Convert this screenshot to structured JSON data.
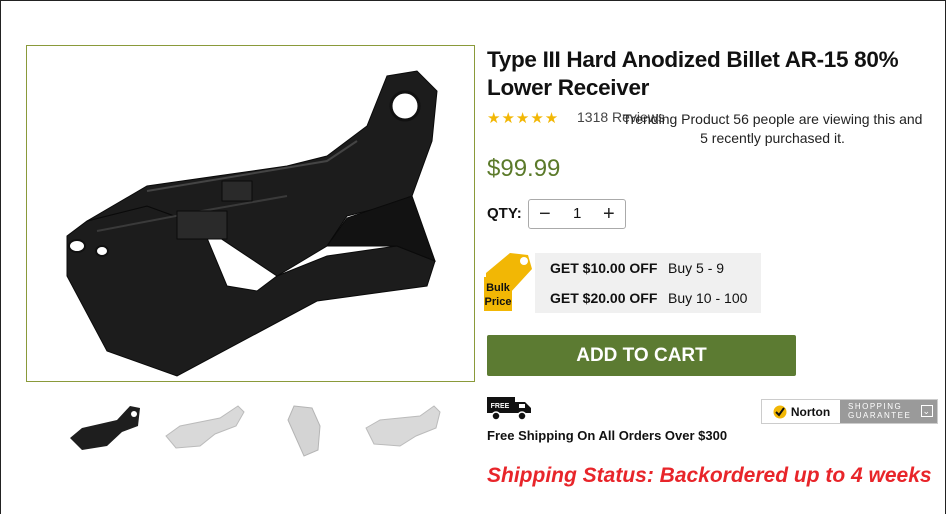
{
  "product": {
    "title": "Type III Hard Anodized Billet AR-15 80% Lower Receiver",
    "stars": "★★★★★",
    "review_count": "1318 Reviews",
    "trending_text": "Trending Product 56 people are viewing this and 5 recently purchased it.",
    "price": "$99.99"
  },
  "quantity": {
    "label": "QTY:",
    "minus": "−",
    "value": "1",
    "plus": "+"
  },
  "bulk_pricing": {
    "badge_line1": "Bulk",
    "badge_line2": "Price",
    "tiers": [
      {
        "offer": "GET $10.00 OFF",
        "range": "Buy 5 - 9"
      },
      {
        "offer": "GET $20.00 OFF",
        "range": "Buy 10 - 100"
      }
    ]
  },
  "cart": {
    "button_label": "ADD TO CART"
  },
  "shipping": {
    "truck_badge": "FREE",
    "free_shipping_text": "Free Shipping On All Orders Over $300",
    "status_text": "Shipping Status: Backordered up to 4 weeks"
  },
  "norton": {
    "brand": "Norton",
    "guarantee_line1": "SHOPPING",
    "guarantee_line2": "GUARANTEE",
    "check_color": "#f2b705"
  },
  "thumbnails": [
    {
      "icon": "black-receiver-thumb"
    },
    {
      "icon": "raw-receiver-thumb"
    },
    {
      "icon": "raw-receiver-front-thumb"
    },
    {
      "icon": "raw-receiver-side-thumb"
    }
  ],
  "colors": {
    "accent_green": "#5c7b32",
    "price_green": "#5b7a2a",
    "status_red": "#e8252a",
    "star_yellow": "#f2b705"
  }
}
